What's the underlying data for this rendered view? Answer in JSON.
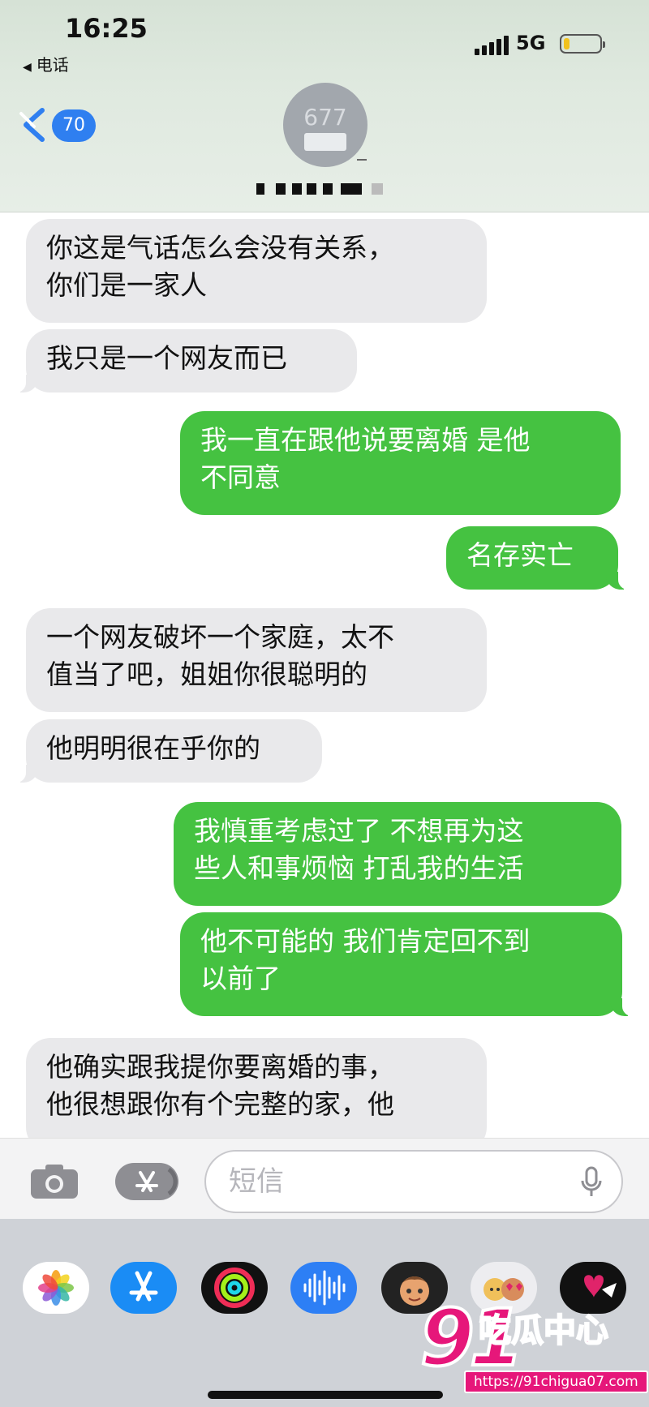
{
  "status_bar": {
    "time": "16:25",
    "back_app": "电话",
    "network": "5G",
    "battery_level": 0.15,
    "battery_color": "#f2c21d"
  },
  "nav": {
    "back_icon": "chevron-left-icon",
    "unread_count": "70",
    "badge_color": "#2f7ff0",
    "avatar_initials": "677"
  },
  "messages": [
    {
      "direction": "incoming",
      "text": "你这是气话怎么会没有关系，\n你们是一家人"
    },
    {
      "direction": "incoming",
      "text": "我只是一个网友而已"
    },
    {
      "direction": "outgoing",
      "text": "我一直在跟他说要离婚  是他\n不同意"
    },
    {
      "direction": "outgoing",
      "text": "名存实亡"
    },
    {
      "direction": "incoming",
      "text": "一个网友破坏一个家庭，太不\n值当了吧，姐姐你很聪明的"
    },
    {
      "direction": "incoming",
      "text": "他明明很在乎你的"
    },
    {
      "direction": "outgoing",
      "text": "我慎重考虑过了  不想再为这\n些人和事烦恼 打乱我的生活"
    },
    {
      "direction": "outgoing",
      "text": "他不可能的  我们肯定回不到\n以前了"
    },
    {
      "direction": "incoming",
      "text": "他确实跟我提你要离婚的事，\n他很想跟你有个完整的家，他"
    }
  ],
  "colors": {
    "incoming_bubble": "#e9e9eb",
    "outgoing_bubble": "#45c241"
  },
  "input_bar": {
    "placeholder": "短信",
    "camera_icon": "camera-icon",
    "apps_icon": "app-store-icon",
    "mic_icon": "microphone-icon"
  },
  "app_drawer": {
    "apps": [
      "photos-icon",
      "app-store-icon",
      "activity-icon",
      "audio-message-icon",
      "memoji-icon",
      "memoji-stickers-icon",
      "digital-touch-icon"
    ]
  },
  "watermark": {
    "number": "91",
    "title": "吃瓜中心",
    "url": "https://91chigua07.com"
  }
}
